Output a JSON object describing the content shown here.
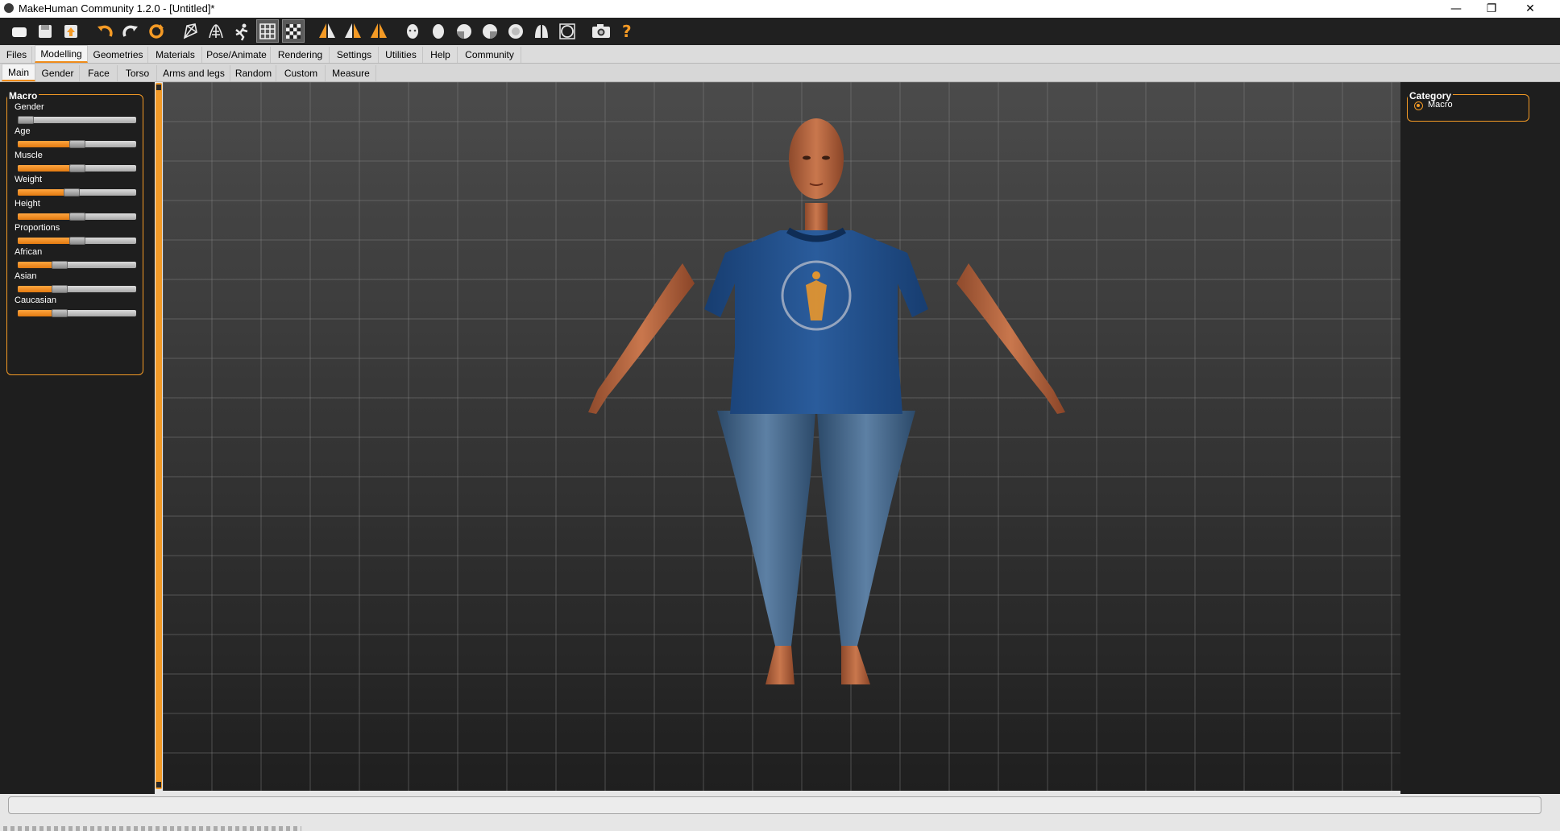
{
  "window": {
    "title": "MakeHuman Community 1.2.0 - [Untitled]*",
    "controls": [
      "minimize-icon",
      "restore-icon",
      "close-icon"
    ]
  },
  "toolbar": {
    "icons": [
      "new-icon",
      "save-icon",
      "export-icon",
      "undo-icon",
      "redo-icon",
      "reset-icon",
      "wireframe-icon",
      "skeleton-icon",
      "pose-icon",
      "grid-icon",
      "checker-icon",
      "front-view-icon",
      "side-view-icon",
      "back-view-icon",
      "head-icon",
      "face-icon",
      "left-view-icon",
      "right-view-icon",
      "top-view-icon",
      "bottom-view-icon",
      "reset-camera-icon",
      "screenshot-icon",
      "help-icon"
    ]
  },
  "main_tabs": [
    "Files",
    "Modelling",
    "Geometries",
    "Materials",
    "Pose/Animate",
    "Rendering",
    "Settings",
    "Utilities",
    "Help",
    "Community"
  ],
  "main_tab_selected": "Modelling",
  "sub_tabs": [
    "Main",
    "Gender",
    "Face",
    "Torso",
    "Arms and legs",
    "Random",
    "Custom",
    "Measure"
  ],
  "sub_tab_selected": "Main",
  "macro": {
    "title": "Macro",
    "sliders": [
      {
        "label": "Gender",
        "value": 0.0
      },
      {
        "label": "Age",
        "value": 0.5
      },
      {
        "label": "Muscle",
        "value": 0.5
      },
      {
        "label": "Weight",
        "value": 0.45
      },
      {
        "label": "Height",
        "value": 0.5
      },
      {
        "label": "Proportions",
        "value": 0.5
      },
      {
        "label": "African",
        "value": 0.33
      },
      {
        "label": "Asian",
        "value": 0.33
      },
      {
        "label": "Caucasian",
        "value": 0.33
      }
    ]
  },
  "category": {
    "title": "Category",
    "options": [
      "Macro"
    ],
    "selected": "Macro"
  },
  "colors": {
    "accent": "#f49a25",
    "panel": "#1e1e1e",
    "shirt": "#1f4f8f",
    "jeans": "#3f6487",
    "skin": "#b8663e"
  }
}
